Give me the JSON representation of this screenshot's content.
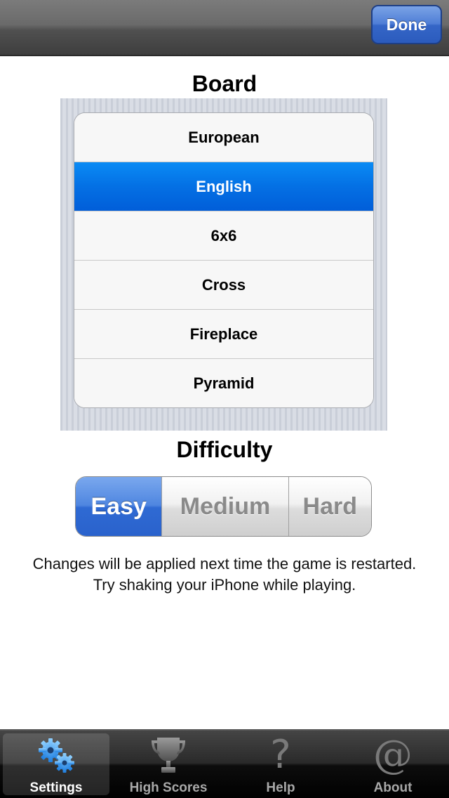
{
  "navbar": {
    "done_label": "Done"
  },
  "board": {
    "title": "Board",
    "selected": "English",
    "options": [
      "European",
      "English",
      "6x6",
      "Cross",
      "Fireplace",
      "Pyramid"
    ]
  },
  "difficulty": {
    "title": "Difficulty",
    "selected": "Easy",
    "options": [
      "Easy",
      "Medium",
      "Hard"
    ]
  },
  "note": "Changes will be applied next time the game is restarted. Try shaking your iPhone while playing.",
  "tabbar": {
    "selected": "Settings",
    "tabs": [
      {
        "label": "Settings",
        "icon": "gears-icon"
      },
      {
        "label": "High Scores",
        "icon": "trophy-icon"
      },
      {
        "label": "Help",
        "icon": "question-mark-icon"
      },
      {
        "label": "About",
        "icon": "at-sign-icon"
      }
    ]
  },
  "colors": {
    "accent_blue": "#0470e4",
    "segment_blue": "#4f86e0",
    "navbar_gray": "#6a6a6a"
  }
}
